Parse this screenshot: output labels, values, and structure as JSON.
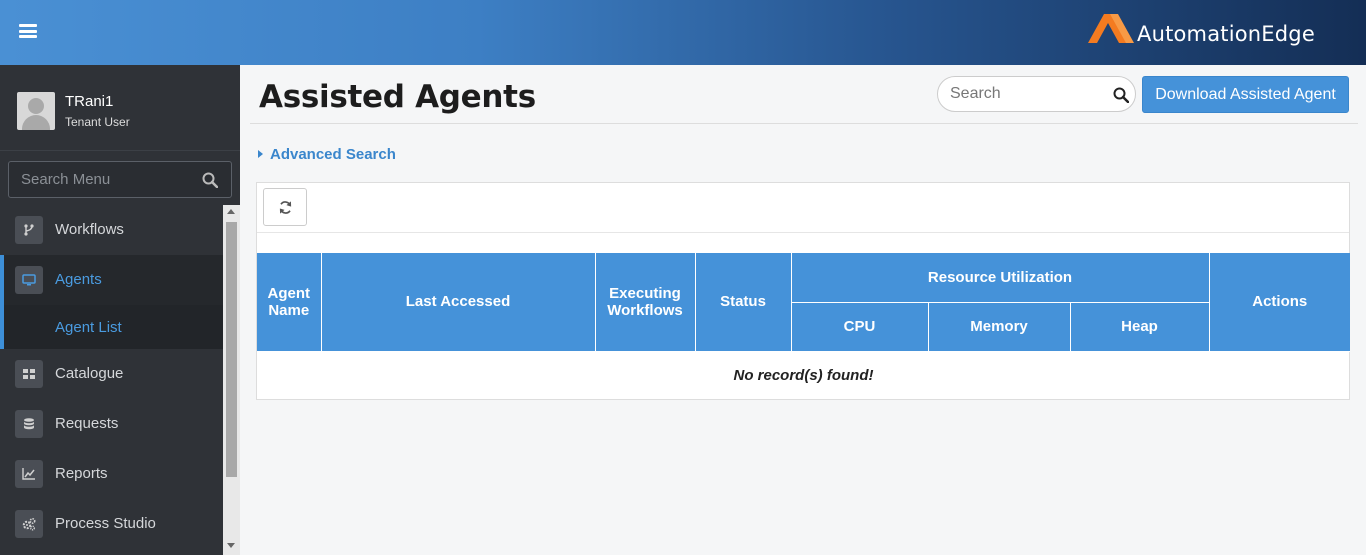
{
  "header": {
    "menu_icon": "hamburger-icon",
    "brand_name": "AutomationEdge",
    "brand_color": "#f47b20"
  },
  "sidebar": {
    "user": {
      "name": "TRani1",
      "role": "Tenant User"
    },
    "search_placeholder": "Search Menu",
    "items": [
      {
        "label": "Workflows",
        "icon": "workflow-icon"
      },
      {
        "label": "Agents",
        "icon": "monitor-icon",
        "active": true
      },
      {
        "label": "Catalogue",
        "icon": "grid-icon"
      },
      {
        "label": "Requests",
        "icon": "database-icon"
      },
      {
        "label": "Reports",
        "icon": "chart-icon"
      },
      {
        "label": "Process Studio",
        "icon": "gears-icon"
      }
    ],
    "subitems": [
      {
        "label": "Agent List",
        "active": true
      }
    ]
  },
  "main": {
    "title": "Assisted Agents",
    "search_placeholder": "Search",
    "download_label": "Download Assisted Agent",
    "advanced_search_label": "Advanced Search",
    "accent_color": "#4592d9",
    "table": {
      "headers": {
        "agent_name": "Agent Name",
        "last_accessed": "Last Accessed",
        "executing_workflows": "Executing Workflows",
        "status": "Status",
        "resource_utilization": "Resource Utilization",
        "cpu": "CPU",
        "memory": "Memory",
        "heap": "Heap",
        "actions": "Actions"
      },
      "rows": [],
      "empty_message": "No record(s) found!"
    }
  }
}
